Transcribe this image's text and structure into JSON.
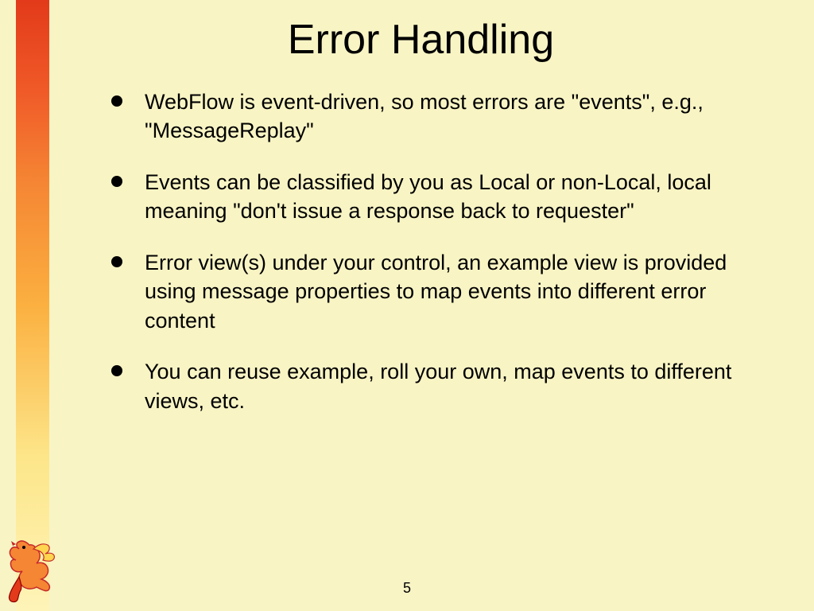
{
  "slide": {
    "title": "Error Handling",
    "bullets": [
      "WebFlow is event-driven, so most errors are \"events\", e.g., \"MessageReplay\"",
      "Events can be classified by you as Local or non-Local, local meaning \"don't issue a response back to requester\"",
      "Error view(s) under your control, an example view is provided using message properties to map events into different error content",
      "You can reuse example, roll your own, map events to different views, etc."
    ],
    "page_number": "5"
  }
}
